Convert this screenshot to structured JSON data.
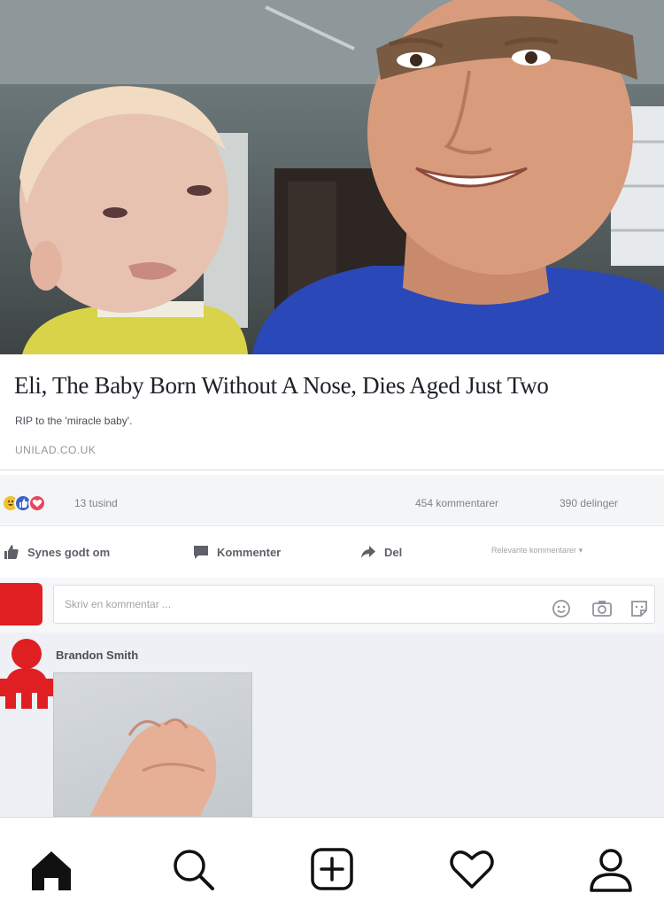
{
  "post": {
    "headline": "Eli, The Baby Born Without A Nose, Dies Aged Just Two",
    "subline": "RIP to the 'miracle baby'.",
    "domain": "UNILAD.CO.UK"
  },
  "stats": {
    "reactions": [
      "haha",
      "like",
      "love"
    ],
    "reaction_count": "13 tusind",
    "comment_count": "454 kommentarer",
    "share_count": "390 delinger"
  },
  "actions": {
    "like_label": "Synes godt om",
    "comment_label": "Kommenter",
    "share_label": "Del",
    "relevant_label": "Relevante kommentarer"
  },
  "composer": {
    "placeholder": "Skriv en kommentar ...",
    "icons": [
      "emoji-icon",
      "camera-icon",
      "sticker-icon"
    ]
  },
  "comment": {
    "author": "Brandon Smith",
    "avatar_color": "#e01f23"
  },
  "tabbar": {
    "tabs": [
      "home-icon",
      "search-icon",
      "new-post-icon",
      "heart-icon",
      "profile-icon"
    ],
    "active": "home-icon"
  },
  "colors": {
    "like_blue": "#3b63c8",
    "love_red": "#e8455f",
    "haha_yellow": "#f0c231",
    "shirt_blue": "#2a48b8"
  }
}
